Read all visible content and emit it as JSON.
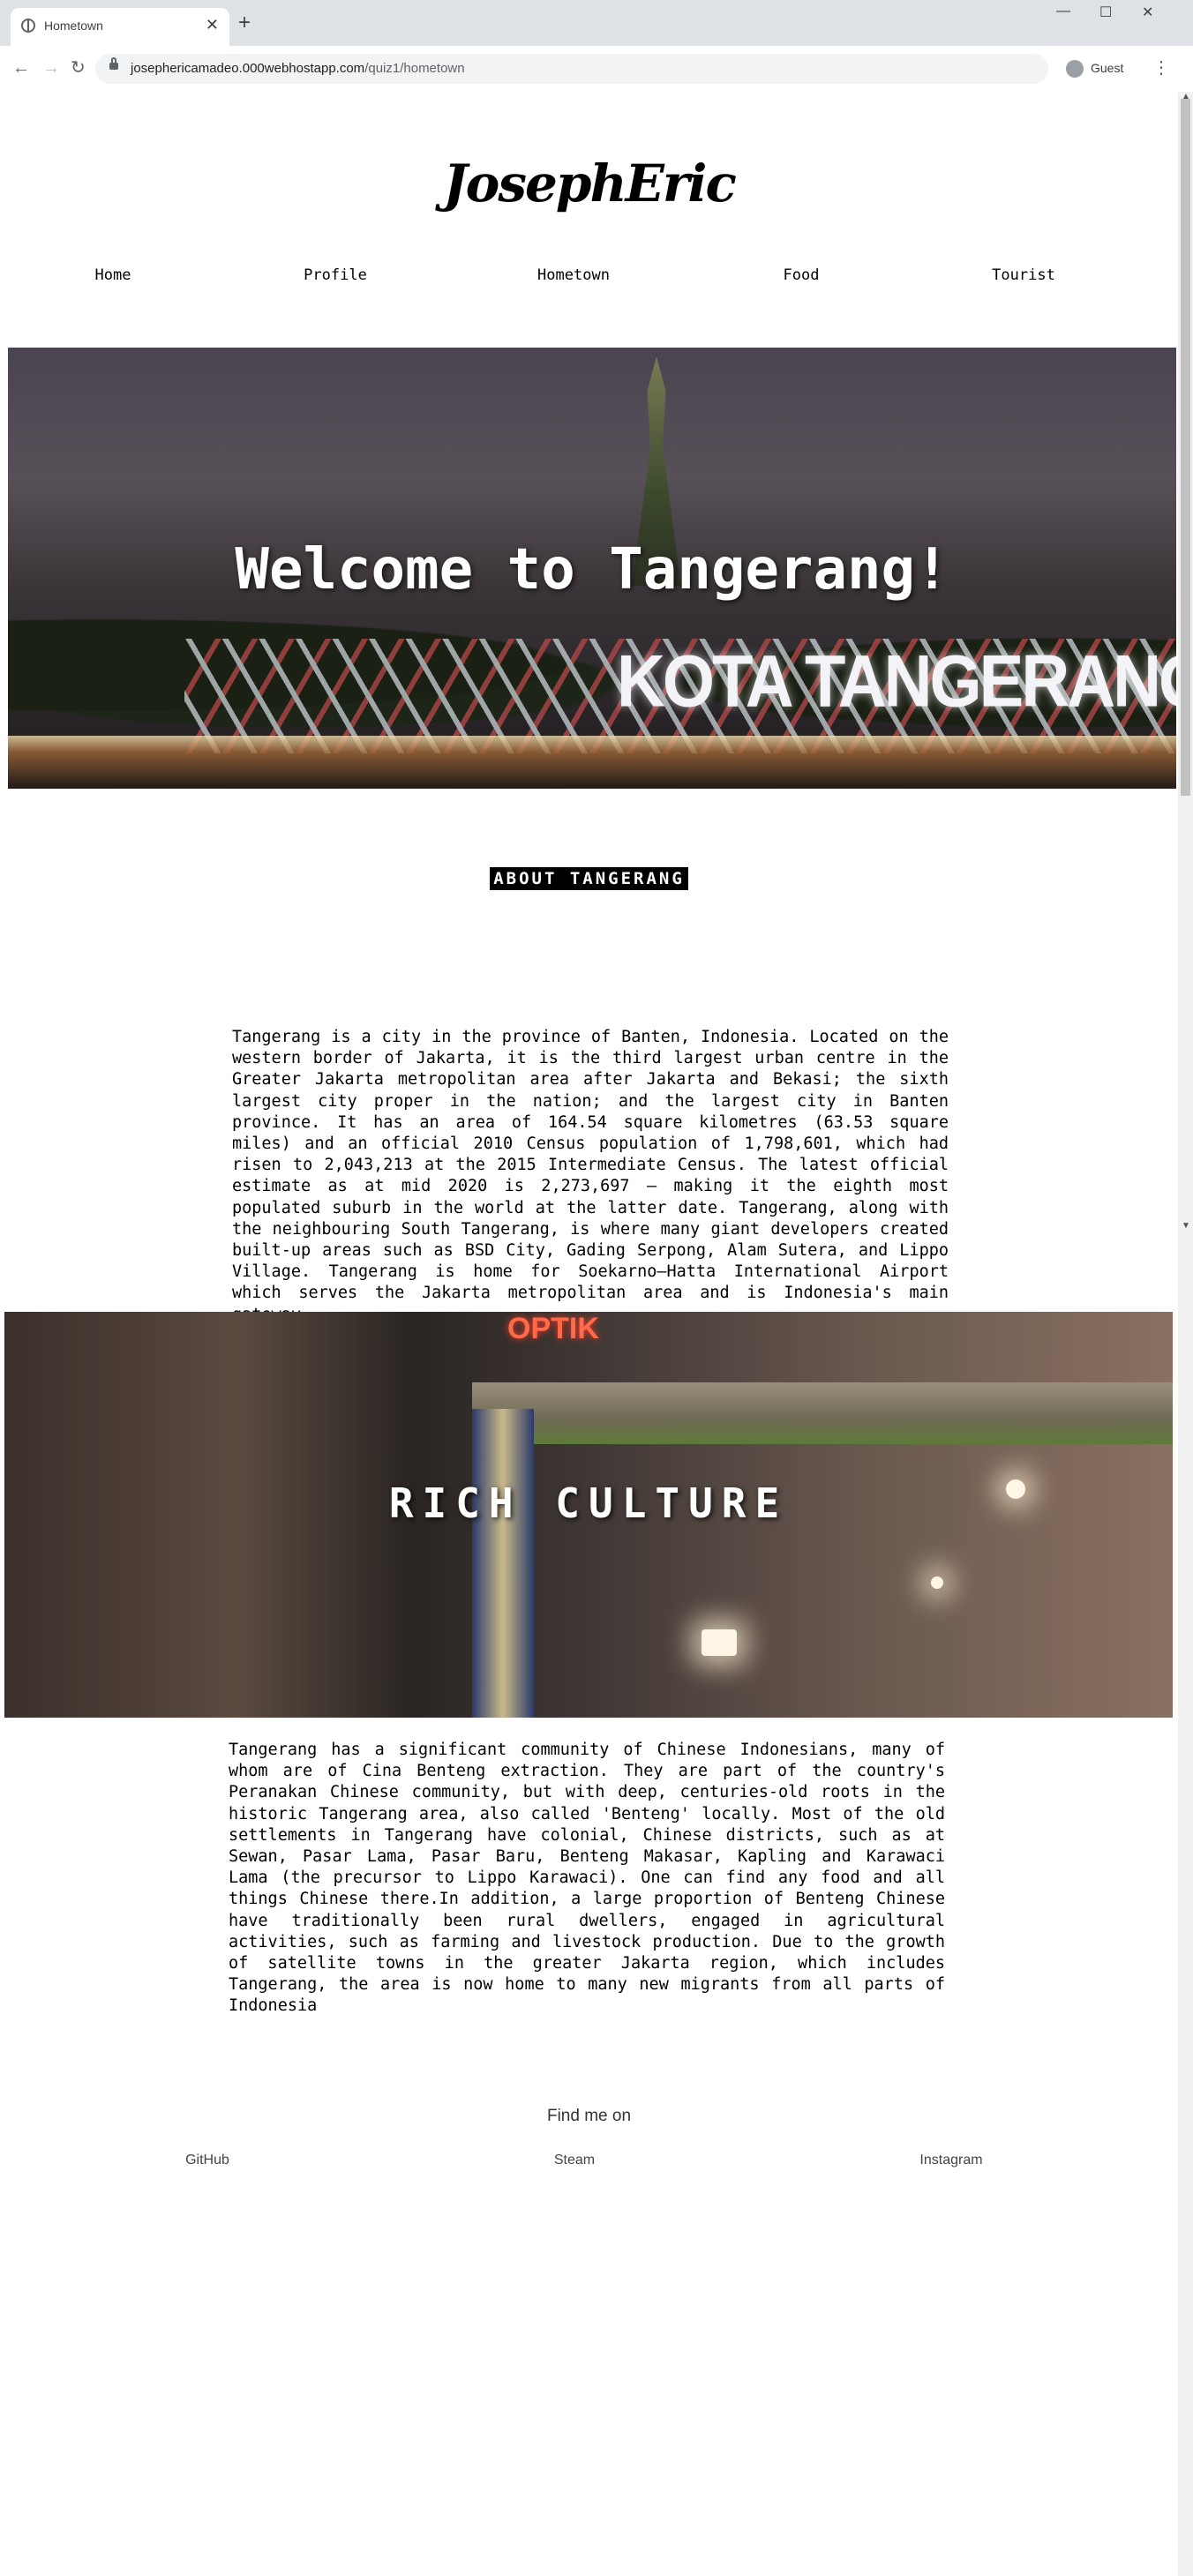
{
  "browser": {
    "tab_title": "Hometown",
    "url_host": "josephericamadeo.000webhostapp.com",
    "url_path": "/quiz1/hometown",
    "profile_label": "Guest"
  },
  "site": {
    "logo": "JosephEric",
    "nav": [
      "Home",
      "Profile",
      "Hometown",
      "Food",
      "Tourist"
    ]
  },
  "hero": {
    "headline": "Welcome to Tangerang!",
    "sign_text": "KOTA TANGERANG"
  },
  "about": {
    "title": "ABOUT TANGERANG",
    "text": "Tangerang is a city in the province of Banten, Indonesia. Located on the western border of Jakarta, it is the third largest urban centre in the Greater Jakarta metropolitan area after Jakarta and Bekasi; the sixth largest city proper in the nation; and the largest city in Banten province. It has an area of 164.54 square kilometres (63.53 square miles) and an official 2010 Census population of 1,798,601, which had risen to 2,043,213 at the 2015 Intermediate Census. The latest official estimate as at mid 2020 is 2,273,697 – making it the eighth most populated suburb in the world at the latter date. Tangerang, along with the neighbouring South Tangerang, is where many giant developers created built-up areas such as BSD City, Gading Serpong, Alam Sutera, and Lippo Village. Tangerang is home for Soekarno–Hatta International Airport which serves the Jakarta metropolitan area and is Indonesia's main gateway."
  },
  "culture": {
    "headline": "RICH CULTURE",
    "neon_text": "OPTIK",
    "text": "Tangerang has a significant community of Chinese Indonesians, many of whom are of Cina Benteng extraction. They are part of the country's Peranakan Chinese community, but with deep, centuries-old roots in the historic Tangerang area, also called 'Benteng' locally. Most of the old settlements in Tangerang have colonial, Chinese districts, such as at Sewan, Pasar Lama, Pasar Baru, Benteng Makasar, Kapling and Karawaci Lama (the precursor to Lippo Karawaci). One can find any food and all things Chinese there.In addition, a large proportion of Benteng Chinese have traditionally been rural dwellers, engaged in agricultural activities, such as farming and livestock production. Due to the growth of satellite towns in the greater Jakarta region, which includes Tangerang, the area is now home to many new migrants from all parts of Indonesia"
  },
  "footer": {
    "title": "Find me on",
    "links": [
      "GitHub",
      "Steam",
      "Instagram"
    ]
  }
}
